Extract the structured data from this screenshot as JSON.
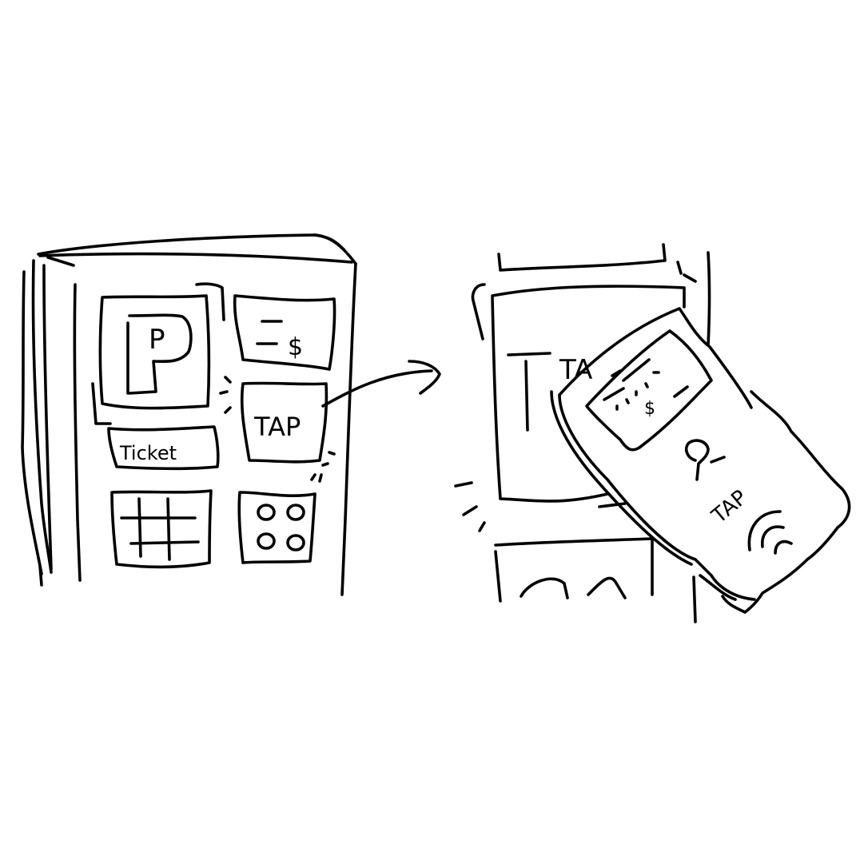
{
  "illustration": {
    "kiosk": {
      "parking_sign_letter": "P",
      "pay_screen_currency": "$",
      "tap_button_label": "TAP",
      "ticket_button_label": "Ticket"
    },
    "phone_tap": {
      "reader_label_partial": "TA",
      "phone_screen_currency": "$",
      "card_label": "TAP"
    },
    "colors": {
      "ink": "#000000",
      "paper": "#ffffff"
    }
  }
}
